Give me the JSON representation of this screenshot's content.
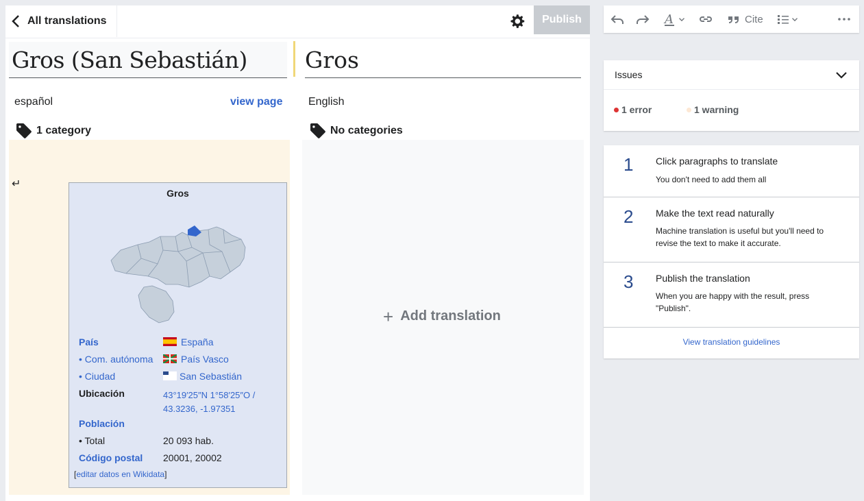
{
  "header": {
    "back_label": "All translations",
    "publish_label": "Publish"
  },
  "source": {
    "title": "Gros (San Sebastián)",
    "language": "español",
    "view_page": "view page",
    "categories": "1 category"
  },
  "target": {
    "title": "Gros",
    "language": "English",
    "categories": "No categories",
    "add_translation": "Add translation",
    "add_icon": "+"
  },
  "infobox": {
    "title": "Gros",
    "rows": {
      "pais_label": "País",
      "pais_value": "España",
      "com_label": "• Com. autónoma",
      "com_value": "País Vasco",
      "ciudad_label": "• Ciudad",
      "ciudad_value": "San Sebastián",
      "ubicacion_label": "Ubicación",
      "ubicacion_value": "43°19′25″N 1°58′25″O / 43.3236, -1.97351",
      "poblacion_label": "Población",
      "total_label": "• Total",
      "total_value": "20 093 hab.",
      "cp_label": "Código postal",
      "cp_value": "20001, 20002"
    },
    "edit_link": "editar datos en Wikidata",
    "edit_open": "[",
    "edit_close": "]"
  },
  "toolbar": {
    "cite_label": "Cite",
    "icons": [
      "undo-icon",
      "redo-icon",
      "text-style-icon",
      "link-icon",
      "quote-icon",
      "list-icon",
      "more-icon"
    ]
  },
  "issues": {
    "label": "Issues",
    "error": "1 error",
    "warning": "1 warning",
    "error_color": "#d33",
    "warning_color": "#fde8d4"
  },
  "steps": [
    {
      "num": "1",
      "title": "Click paragraphs to translate",
      "desc": "You don't need to add them all"
    },
    {
      "num": "2",
      "title": "Make the text read naturally",
      "desc": "Machine translation is useful but you'll need to revise the text to make it accurate."
    },
    {
      "num": "3",
      "title": "Publish the translation",
      "desc": "When you are happy with the result, press \"Publish\"."
    }
  ],
  "guidelines_link": "View translation guidelines",
  "colors": {
    "accent": "#3366cc",
    "source_bg": "#fdf5e6",
    "infobox_bg": "#e0e6f4",
    "publish_disabled": "#c8ccd1"
  }
}
